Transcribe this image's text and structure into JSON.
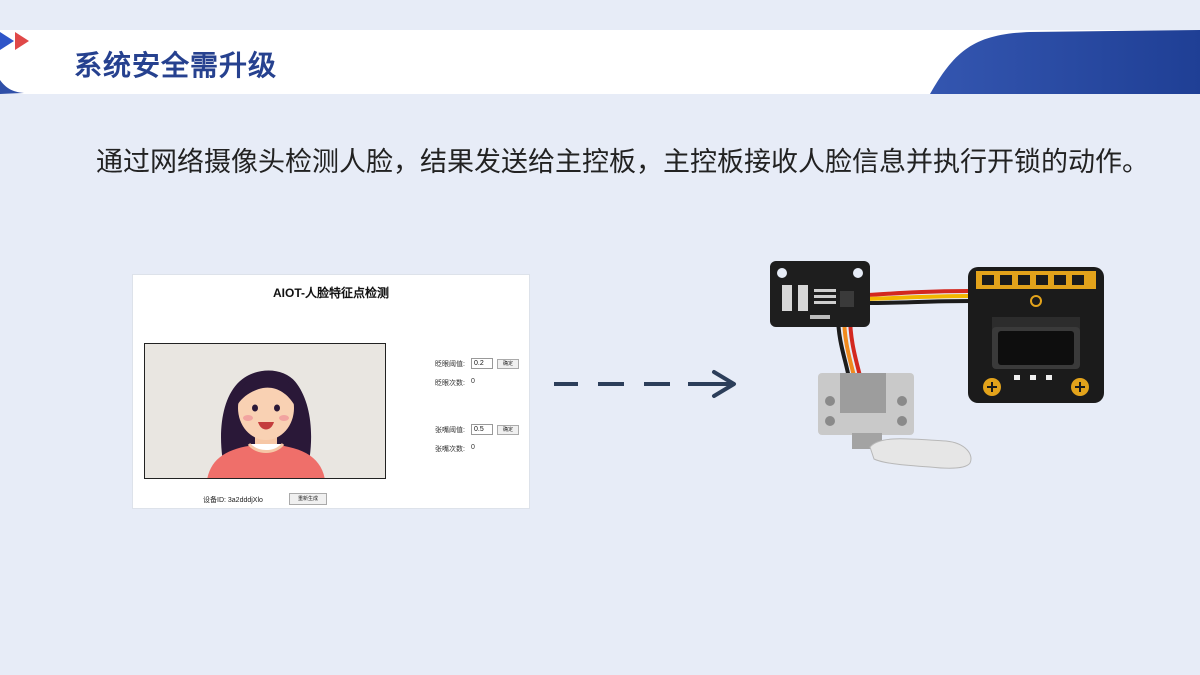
{
  "header": {
    "title": "系统安全需升级"
  },
  "body": {
    "text": "通过网络摄像头检测人脸，结果发送给主控板，主控板接收人脸信息并执行开锁的动作。"
  },
  "app": {
    "title": "AIOT-人脸特征点检测",
    "blink_threshold_label": "眨眼阈值:",
    "blink_threshold_value": "0.2",
    "blink_confirm": "确定",
    "blink_count_label": "眨眼次数:",
    "blink_count_value": "0",
    "mouth_threshold_label": "张嘴阈值:",
    "mouth_threshold_value": "0.5",
    "mouth_confirm": "确定",
    "mouth_count_label": "张嘴次数:",
    "mouth_count_value": "0",
    "device_id": "设备ID: 3a2dddjXlo",
    "regenerate": "重新生成"
  },
  "colors": {
    "brand_blue": "#26418f",
    "arrow_red": "#e04848",
    "arrow_blue": "#2f55c8",
    "flow_arrow": "#2c3e5a"
  },
  "icons": {
    "header_marker": "double-triangle-icon",
    "flow": "dashed-arrow-icon"
  }
}
